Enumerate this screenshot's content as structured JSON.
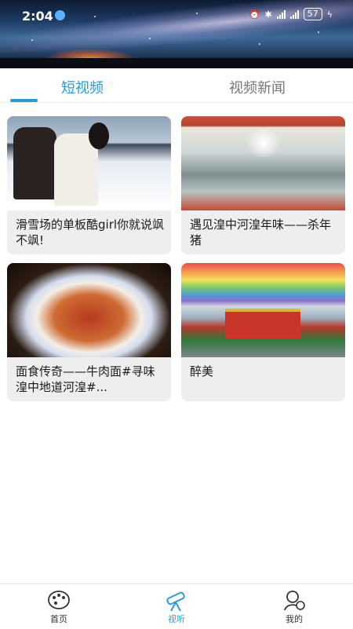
{
  "status_bar": {
    "time": "2:04",
    "battery": "57"
  },
  "tabs": [
    {
      "label": "短视频",
      "active": true
    },
    {
      "label": "视频新闻",
      "active": false
    }
  ],
  "videos": [
    {
      "title": "滑雪场的单板酷girl你就说飒不飒!"
    },
    {
      "title": "遇见湟中河湟年味——杀年猪"
    },
    {
      "title": "面食传奇——牛肉面#寻味湟中地道河湟#..."
    },
    {
      "title": "醉美"
    }
  ],
  "bottom_nav": [
    {
      "label": "首页",
      "icon": "palette-icon",
      "active": false
    },
    {
      "label": "视听",
      "icon": "telescope-icon",
      "active": true
    },
    {
      "label": "我的",
      "icon": "profile-icon",
      "active": false
    }
  ],
  "colors": {
    "accent": "#2c9ad6",
    "text_inactive": "#777777",
    "card_bg": "#eeeeee"
  }
}
